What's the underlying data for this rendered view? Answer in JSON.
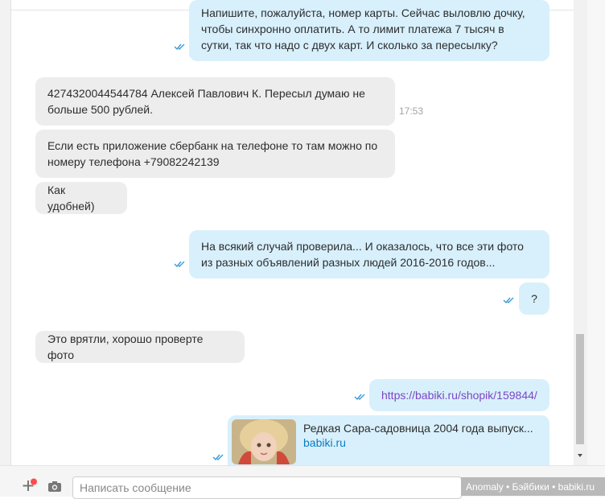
{
  "messages": [
    {
      "dir": "out",
      "lines": [
        "Напишите, пожалуйста, номер карты. Сейчас выловлю дочку,",
        "чтобы синхронно оплатить. А то лимит платежа 7 тысяч в",
        "сутки, так что надо с двух карт. И сколько за пересылку?"
      ]
    },
    {
      "dir": "in",
      "lines": [
        "4274320044544784 Алексей Павлович К. Пересыл думаю не",
        "больше 500 рублей."
      ],
      "time": "17:53"
    },
    {
      "dir": "in",
      "lines": [
        "Если есть приложение сбербанк на телефоне то там можно по",
        "номеру телефона +79082242139"
      ]
    },
    {
      "dir": "in",
      "lines": [
        "Как удобней)"
      ]
    },
    {
      "dir": "out",
      "lines": [
        "На всякий случай проверила... И оказалось, что все эти фото",
        "из разных объявлений разных людей 2016-2016 годов..."
      ]
    },
    {
      "dir": "out",
      "lines": [
        "?"
      ]
    },
    {
      "dir": "in",
      "lines": [
        "Это врятли, хорошо проверте фото"
      ]
    },
    {
      "dir": "out",
      "link": "https://babiki.ru/shopik/159844/"
    },
    {
      "dir": "out",
      "card": {
        "title": "Редкая Сара-садовница 2004 года выпуск...",
        "domain": "babiki.ru"
      }
    }
  ],
  "composer": {
    "placeholder": "Написать сообщение"
  },
  "watermark": "Anomaly • Бэйбики • babiki.ru",
  "colors": {
    "out_bubble": "#d8f0fc",
    "in_bubble": "#ededed",
    "tick": "#3a9ad9",
    "link": "#7b47c2"
  }
}
